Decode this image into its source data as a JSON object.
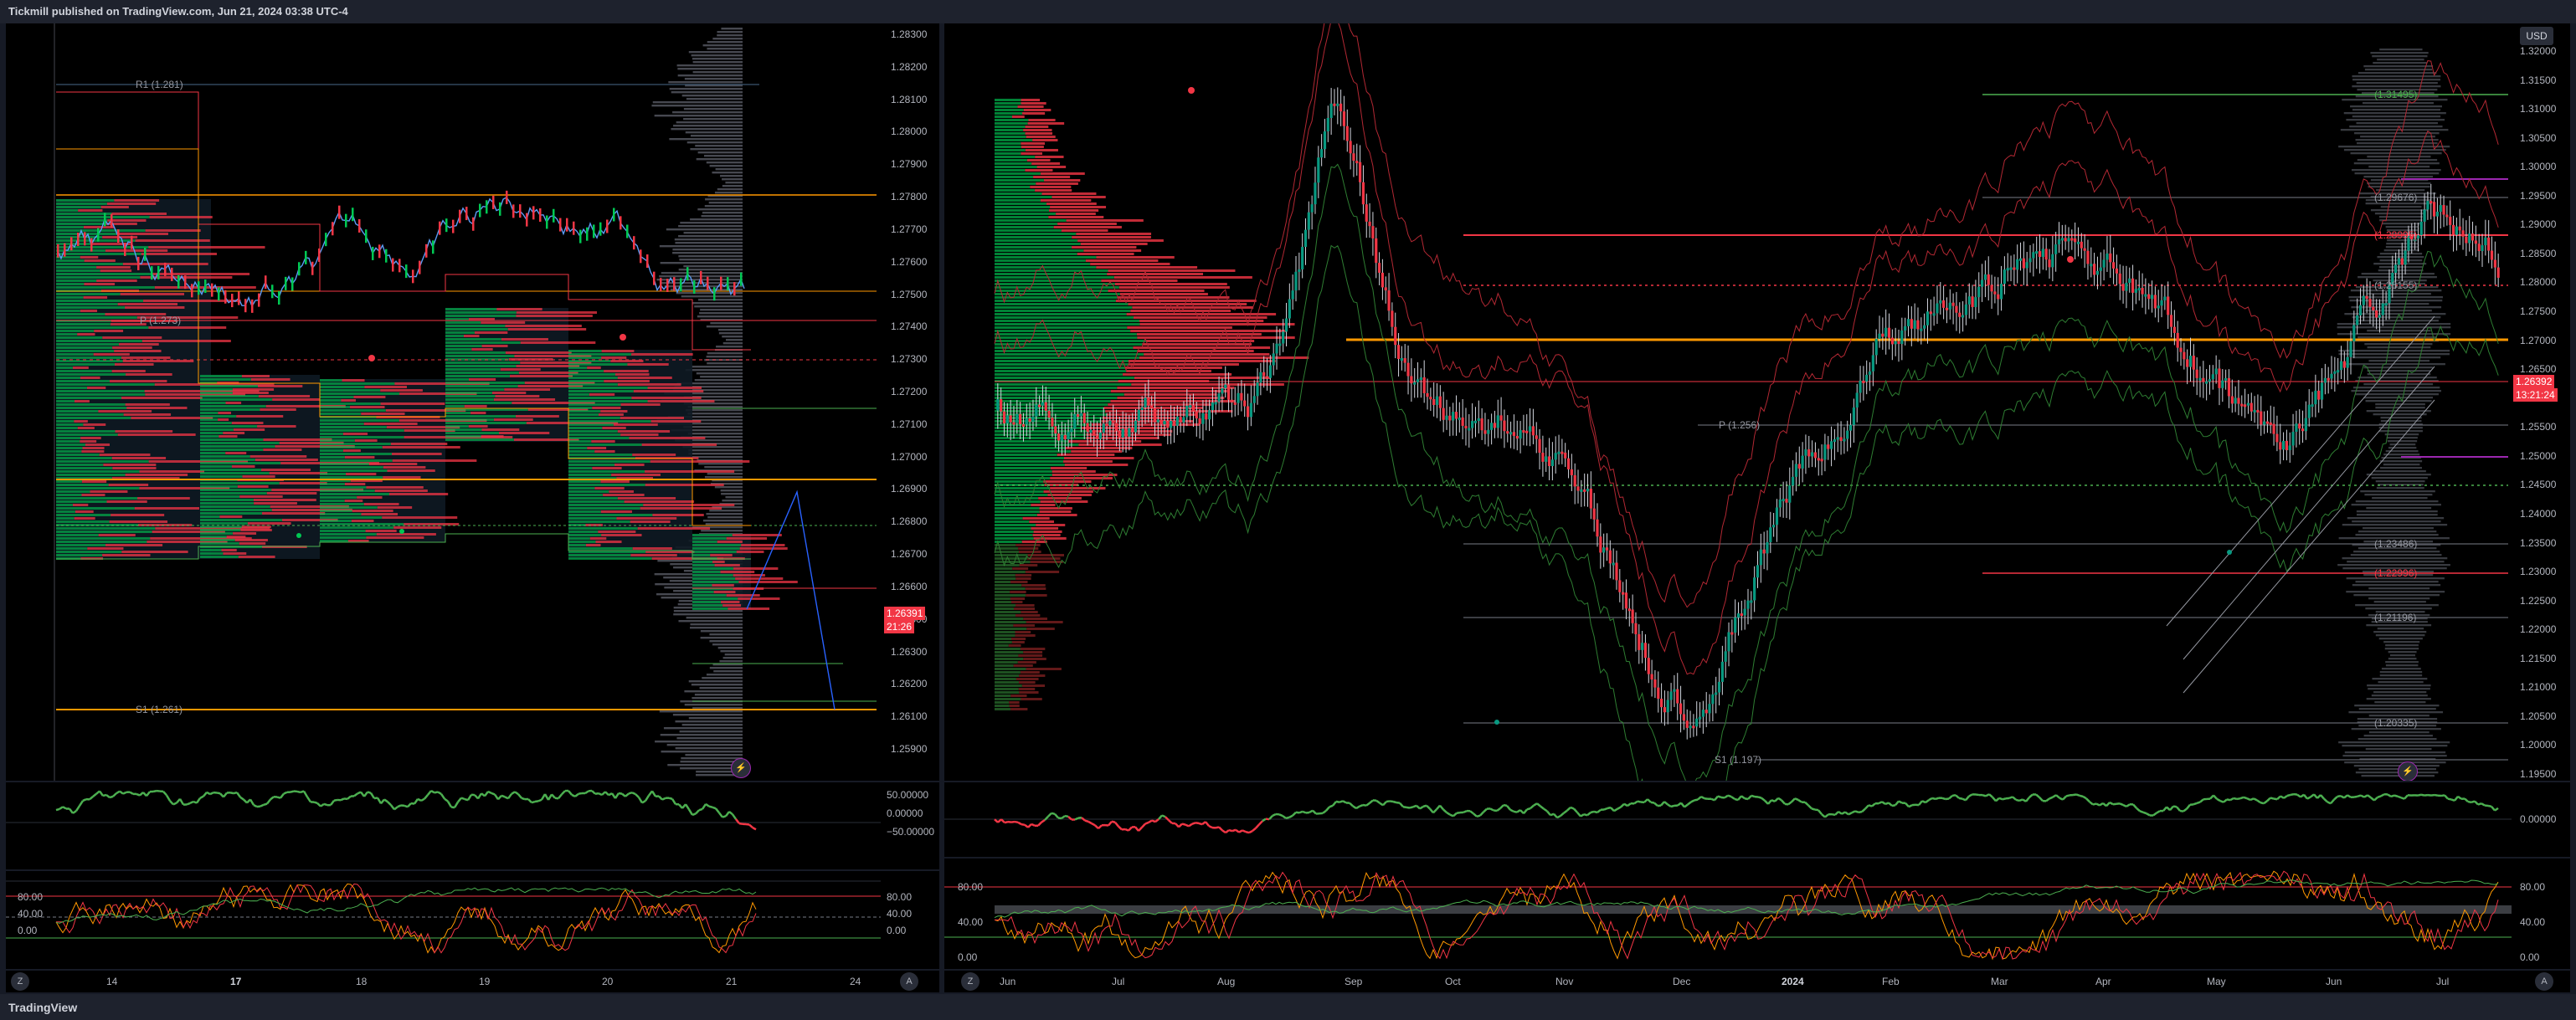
{
  "header": {
    "publisher_text": "Tickmill published on TradingView.com, Jun 21, 2024 03:38 UTC-4"
  },
  "footer": {
    "logo_text": "TradingView",
    "logo_icon": "tradingview-logo-icon"
  },
  "left_chart": {
    "price_axis": [
      "1.28300",
      "1.28200",
      "1.28100",
      "1.28000",
      "1.27900",
      "1.27800",
      "1.27700",
      "1.27600",
      "1.27500",
      "1.27400",
      "1.27300",
      "1.27200",
      "1.27100",
      "1.27000",
      "1.26900",
      "1.26800",
      "1.26700",
      "1.26600",
      "1.26500",
      "1.26300",
      "1.26200",
      "1.26100",
      "1.25900"
    ],
    "current_price": "1.26391",
    "countdown": "21:26",
    "levels": {
      "r1": "R1 (1.281)",
      "p": "P (1.273)",
      "s1": "S1 (1.261)"
    },
    "date_axis": [
      {
        "label": "14",
        "bold": false
      },
      {
        "label": "17",
        "bold": true
      },
      {
        "label": "18",
        "bold": false
      },
      {
        "label": "19",
        "bold": false
      },
      {
        "label": "20",
        "bold": false
      },
      {
        "label": "21",
        "bold": false
      },
      {
        "label": "24",
        "bold": false
      }
    ],
    "macd_axis": [
      "50.00000",
      "0.00000",
      "−50.00000"
    ],
    "stoch_axis_left": [
      "80.00",
      "40.00",
      "0.00"
    ],
    "stoch_axis_right": [
      "80.00",
      "40.00",
      "0.00"
    ],
    "corner_left": "Z",
    "corner_right": "A"
  },
  "right_chart": {
    "currency_button": "USD",
    "price_axis": [
      "1.32000",
      "1.31500",
      "1.31000",
      "1.30500",
      "1.30000",
      "1.29500",
      "1.29000",
      "1.28500",
      "1.28000",
      "1.27500",
      "1.27000",
      "1.26500",
      "1.26000",
      "1.25500",
      "1.25000",
      "1.24500",
      "1.24000",
      "1.23500",
      "1.23000",
      "1.22500",
      "1.22000",
      "1.21500",
      "1.21000",
      "1.20500",
      "1.20000",
      "1.19500"
    ],
    "current_price": "1.26392",
    "countdown": "13:21:24",
    "levels": {
      "p": "P (1.256)",
      "s1": "S1 (1.197)",
      "l1": "(1.31495)",
      "l2": "(1.29676)",
      "l3": "(1.28995)",
      "l4": "(1.28155)",
      "l5": "(1.23486)",
      "l6": "(1.22996)",
      "l7": "(1.21196)",
      "l8": "(1.20335)"
    },
    "date_axis": [
      {
        "label": "Jun",
        "bold": false
      },
      {
        "label": "Jul",
        "bold": false
      },
      {
        "label": "Aug",
        "bold": false
      },
      {
        "label": "Sep",
        "bold": false
      },
      {
        "label": "Oct",
        "bold": false
      },
      {
        "label": "Nov",
        "bold": false
      },
      {
        "label": "Dec",
        "bold": false
      },
      {
        "label": "2024",
        "bold": true
      },
      {
        "label": "Feb",
        "bold": false
      },
      {
        "label": "Mar",
        "bold": false
      },
      {
        "label": "Apr",
        "bold": false
      },
      {
        "label": "May",
        "bold": false
      },
      {
        "label": "Jun",
        "bold": false
      },
      {
        "label": "Jul",
        "bold": false
      }
    ],
    "macd_axis": [
      "0.00000"
    ],
    "stoch_axis_left": [
      "80.00",
      "40.00",
      "0.00"
    ],
    "stoch_axis_right": [
      "80.00",
      "40.00",
      "0.00"
    ],
    "corner_left": "Z",
    "corner_right": "A"
  },
  "colors": {
    "bull": "#089981",
    "bull_bright": "#00c853",
    "bear": "#f23645",
    "orange": "#ff9800",
    "purple": "#9c27b0",
    "blue": "#2962ff",
    "grid": "#2a2e39"
  }
}
